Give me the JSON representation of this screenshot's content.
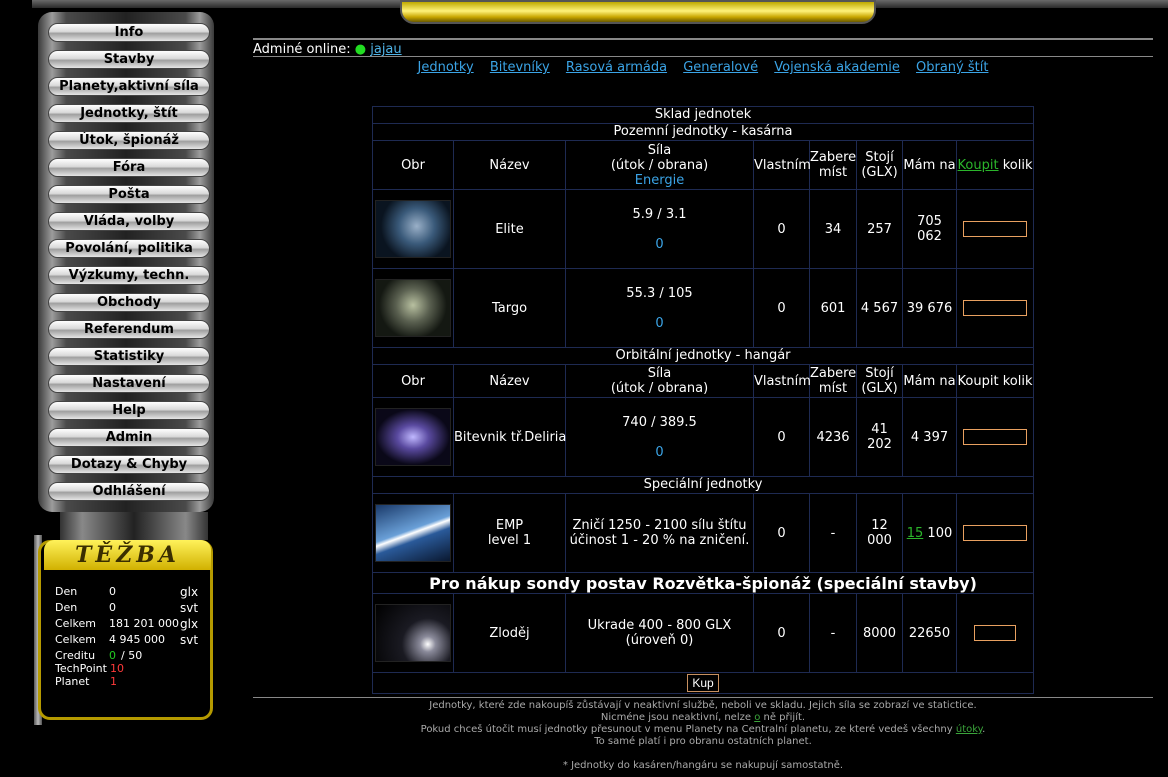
{
  "menu": {
    "items": [
      {
        "label": "Info"
      },
      {
        "label": "Stavby"
      },
      {
        "label": "Planety,aktivní síla"
      },
      {
        "label": "Jednotky, štít"
      },
      {
        "label": "Útok, špionáž"
      },
      {
        "label": "Fóra"
      },
      {
        "label": "Pošta"
      },
      {
        "label": "Vláda, volby"
      },
      {
        "label": "Povolání, politika"
      },
      {
        "label": "Výzkumy, techn."
      },
      {
        "label": "Obchody"
      },
      {
        "label": "Referendum"
      },
      {
        "label": "Statistiky"
      },
      {
        "label": "Nastavení"
      },
      {
        "label": "Help"
      },
      {
        "label": "Admin"
      },
      {
        "label": "Dotazy & Chyby"
      },
      {
        "label": "Odhlášení"
      }
    ]
  },
  "tezba": {
    "title": "TĚŽBA",
    "rows": [
      {
        "label": "Den",
        "value": "0",
        "unit": "glx"
      },
      {
        "label": "Den",
        "value": "0",
        "unit": "svt"
      },
      {
        "label": "Celkem",
        "value": "181 201 000",
        "unit": "glx"
      },
      {
        "label": "Celkem",
        "value": "4 945 000",
        "unit": "svt"
      }
    ],
    "credit_label": "Creditu",
    "credit_value": "0",
    "credit_sep": "/ 50",
    "techpoint_label": "TechPoint",
    "techpoint_value": "10",
    "planet_label": "Planet",
    "planet_value": "1",
    "colors": {
      "credit": "#22cc22",
      "techpoint": "#ff3a3a",
      "planet": "#ff3a3a"
    }
  },
  "admins": {
    "label": "Adminé online:",
    "name": "jajau"
  },
  "nav": [
    "Jednotky",
    "Bitevníky",
    "Rasová armáda",
    "Generalové",
    "Vojenská akademie",
    "Obraný štít"
  ],
  "table": {
    "title": "Sklad jednotek",
    "ground_title": "Pozemní jednotky - kasárna",
    "orbital_title": "Orbitální jednotky - hangár",
    "special_title": "Speciální jednotky",
    "probe_title": "Pro nákup sondy postav Rozvětka-špionáž (speciální stavby)",
    "head": {
      "img": "Obr",
      "name": "Název",
      "power1": "Síla",
      "power2": "(útok / obrana)",
      "energy": "Energie",
      "own": "Vlastním",
      "space1": "Zabere",
      "space2": "míst",
      "cost1": "Stojí",
      "cost2": "(GLX)",
      "have": "Mám na",
      "buy_link": "Koupit",
      "buy_text": "kolik",
      "buy_full": "Koupit kolik"
    },
    "ground": [
      {
        "name": "Elite",
        "power": "5.9 / 3.1",
        "energy": "0",
        "own": "0",
        "space": "34",
        "cost": "257",
        "have": "705 062"
      },
      {
        "name": "Targo",
        "power": "55.3 / 105",
        "energy": "0",
        "own": "0",
        "space": "601",
        "cost": "4 567",
        "have": "39 676"
      }
    ],
    "orbital": [
      {
        "name": "Bitevnik tř.Deliria",
        "power": "740 / 389.5",
        "energy": "0",
        "own": "0",
        "space": "4236",
        "cost": "41 202",
        "have": "4 397"
      }
    ],
    "special": {
      "name1": "EMP",
      "name2": "level 1",
      "desc1": "Zničí 1250 - 2100 sílu štítu",
      "desc2": "účinost 1 - 20 % na zničení.",
      "own": "0",
      "space": "-",
      "cost": "12 000",
      "have_link": "15",
      "have_rest": "100"
    },
    "thief": {
      "name": "Zloděj",
      "desc1": "Ukrade 400 - 800 GLX",
      "desc2": "(úroveň 0)",
      "own": "0",
      "space": "-",
      "cost": "8000",
      "have": "22650"
    },
    "submit": "Kup"
  },
  "footer": {
    "l1": "Jednotky, které zde nakoupíš zůstávají v neaktivní službě, neboli ve skladu. Jejich síla se zobrazí ve statictice.",
    "l2a": "Nicméne jsou neaktivní, nelze ",
    "l2link": "o",
    "l2b": " ně přijít.",
    "l3a": "Pokud chceš útočit musí jednotky přesunout v menu Planety na Centralní planetu, ze které vedeš všechny ",
    "l3link": "útoky",
    "l3b": ".",
    "l4": "To samé platí i pro obranu ostatních planet.",
    "l5": "* Jednotky do kasáren/hangáru se nakupují samostatně."
  }
}
